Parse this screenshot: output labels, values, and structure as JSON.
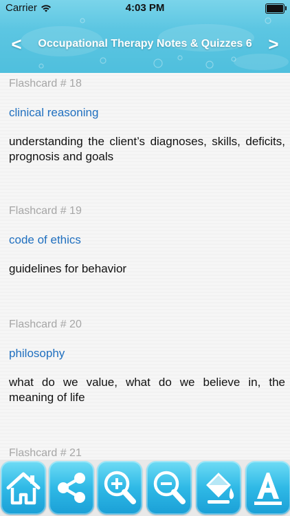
{
  "status_bar": {
    "carrier": "Carrier",
    "time": "4:03 PM"
  },
  "nav": {
    "title": "Occupational Therapy Notes & Quizzes 6",
    "prev": "<",
    "next": ">"
  },
  "cards": [
    {
      "number": "Flashcard # 18",
      "term": "clinical reasoning",
      "definition": "understanding the client’s diagnoses, skills, deficits, prognosis and goals"
    },
    {
      "number": "Flashcard # 19",
      "term": "code of ethics",
      "definition": "guidelines for behavior"
    },
    {
      "number": "Flashcard # 20",
      "term": "philosophy",
      "definition": "what do we value, what do we believe in, the meaning of life"
    },
    {
      "number": "Flashcard # 21"
    }
  ],
  "toolbar": {
    "buttons": [
      "home-icon",
      "share-icon",
      "zoom-in-icon",
      "zoom-out-icon",
      "paint-bucket-icon",
      "font-icon"
    ]
  },
  "colors": {
    "header": "#4fbfdd",
    "term": "#1f6fbf",
    "card_number": "#a6a6a6",
    "button": "#2fb9e6"
  }
}
